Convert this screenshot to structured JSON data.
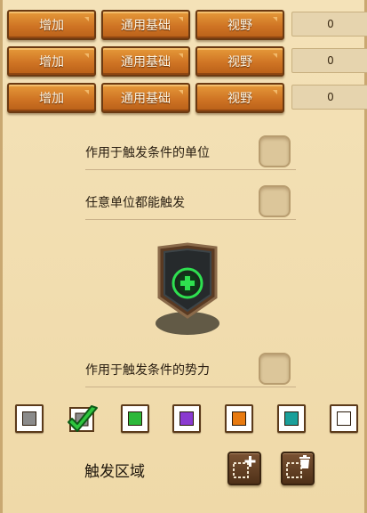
{
  "rows": [
    {
      "add_label": "增加",
      "category_label": "通用基础",
      "attribute_label": "视野",
      "value": "0"
    },
    {
      "add_label": "增加",
      "category_label": "通用基础",
      "attribute_label": "视野",
      "value": "0"
    },
    {
      "add_label": "增加",
      "category_label": "通用基础",
      "attribute_label": "视野",
      "value": "0"
    }
  ],
  "options": {
    "trigger_unit": {
      "label": "作用于触发条件的单位",
      "checked": false
    },
    "any_unit": {
      "label": "任意单位都能触发",
      "checked": false
    },
    "trigger_force": {
      "label": "作用于触发条件的势力",
      "checked": false
    }
  },
  "shield": {
    "icon": "green-plus-icon",
    "accent": "#28d84a"
  },
  "colors": [
    {
      "name": "gray",
      "hex": "#8b8b8b",
      "selected": true
    },
    {
      "name": "red",
      "hex": "#d8282a",
      "selected": false
    },
    {
      "name": "green",
      "hex": "#2cb83a",
      "selected": false
    },
    {
      "name": "purple",
      "hex": "#8a3ad0",
      "selected": false
    },
    {
      "name": "orange",
      "hex": "#e87a10",
      "selected": false
    },
    {
      "name": "teal",
      "hex": "#1a9f9a",
      "selected": false
    }
  ],
  "trigger_area": {
    "label": "触发区域",
    "add_icon": "add-area-icon",
    "delete_icon": "delete-area-icon"
  }
}
